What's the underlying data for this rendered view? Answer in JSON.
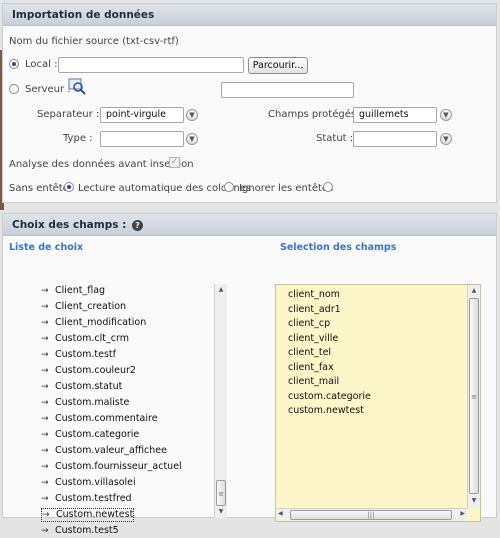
{
  "import_panel": {
    "title": "Importation de données",
    "filename_label": "Nom du fichier source (txt-csv-rtf)",
    "local_label": "Local :",
    "browse_button": "Parcourir...",
    "server_label": "Serveur :",
    "separator_label": "Separateur :",
    "separator_value": "point-virgule",
    "protected_fields_label": "Champs protégés :",
    "protected_fields_value": "guillemets",
    "type_label": "Type :",
    "type_value": "",
    "status_label": "Statut :",
    "status_value": "",
    "analyze_label": "Analyse des données avant insertion",
    "analyze_checked": true,
    "no_header_label": "Sans entête",
    "auto_read_label": "Lecture automatique des colonnes",
    "ignore_headers_label": "Ignorer les entêtes"
  },
  "fields_panel": {
    "title": "Choix des champs :",
    "help_icon": "?",
    "left_title": "Liste de choix",
    "right_title": "Selection des champs",
    "choices": [
      "Client_flag",
      "Client_creation",
      "Client_modification",
      "Custom.clt_crm",
      "Custom.testf",
      "Custom.couleur2",
      "Custom.statut",
      "Custom.maliste",
      "Custom.commentaire",
      "Custom.categorie",
      "Custom.valeur_affichee",
      "Custom.fournisseur_actuel",
      "Custom.villasolei",
      "Custom.testfred",
      "Custom.newtest",
      "Custom.test5"
    ],
    "selected": [
      "client_nom",
      "client_adr1",
      "client_cp",
      "client_ville",
      "client_tel",
      "client_fax",
      "client_mail",
      "custom.categorie",
      "custom.newtest"
    ]
  }
}
